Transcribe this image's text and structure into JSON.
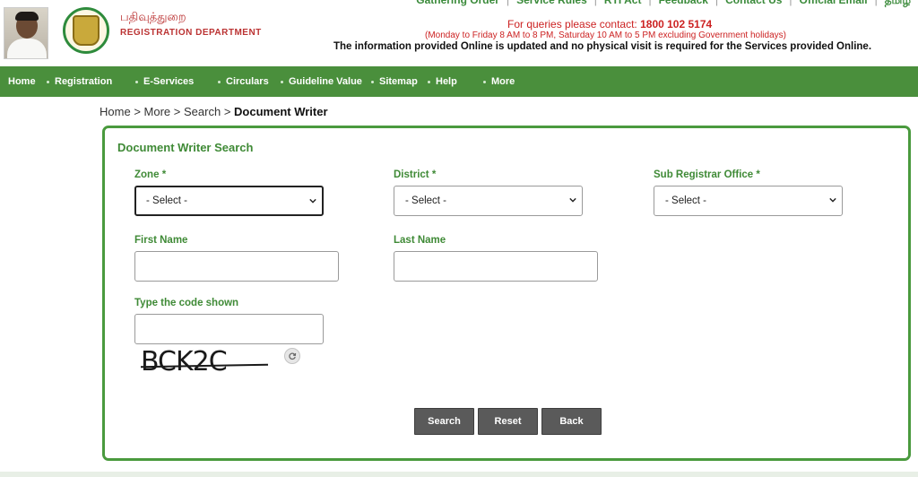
{
  "header": {
    "top_links": [
      "Gathering Order",
      "Service Rules",
      "RTI Act",
      "Feedback",
      "Contact Us",
      "Official Email",
      "தமிழ்"
    ],
    "dept_tamil": "பதிவுத்துறை",
    "dept_name": "REGISTRATION DEPARTMENT",
    "contact_prefix": "For queries please contact:",
    "contact_number": "1800 102 5174",
    "hours": "(Monday to Friday 8 AM to 8 PM, Saturday 10 AM to 5 PM excluding Government holidays)",
    "info": "The information provided Online is updated and no physical visit is required for the Services provided Online."
  },
  "nav": {
    "items": [
      "Home",
      "Registration",
      "E-Services",
      "Circulars",
      "Guideline Value",
      "Sitemap",
      "Help",
      "More"
    ]
  },
  "breadcrumb": {
    "home": "Home",
    "more": "More",
    "search": "Search",
    "current": "Document Writer",
    "sep": ">"
  },
  "form": {
    "title": "Document Writer Search",
    "zone_label": "Zone",
    "zone_value": "- Select -",
    "district_label": "District",
    "district_value": "- Select -",
    "sro_label": "Sub Registrar Office",
    "sro_value": "- Select -",
    "required_mark": "*",
    "first_name_label": "First Name",
    "first_name_value": "",
    "last_name_label": "Last Name",
    "last_name_value": "",
    "captcha_label": "Type the code shown",
    "captcha_value": "",
    "captcha_text": "BCK2C"
  },
  "buttons": {
    "search": "Search",
    "reset": "Reset",
    "back": "Back"
  },
  "icons": {
    "refresh": "refresh-icon",
    "caret": "chevron-down-icon"
  },
  "colors": {
    "nav_green": "#4a8f3c",
    "label_green": "#3f8a36",
    "contact_red": "#cc2222",
    "button_gray": "#5a5a5a"
  }
}
